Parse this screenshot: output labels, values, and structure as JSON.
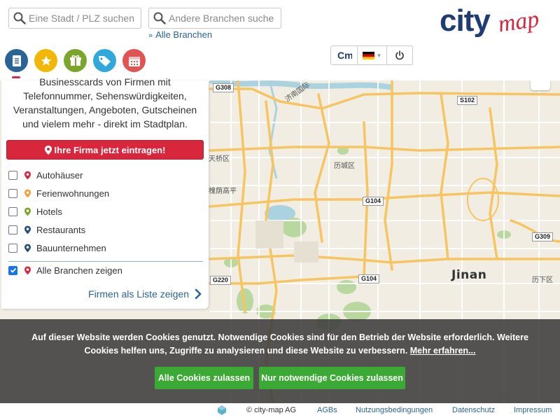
{
  "header": {
    "city_search_placeholder": "Eine Stadt / PLZ suchen",
    "branch_search_placeholder": "Andere Branchen suchen",
    "all_branches_link": "Alle Branchen",
    "logo_text_city": "city",
    "logo_text_map": "map"
  },
  "nav_icons": [
    {
      "name": "list-icon",
      "color": "#2a6496",
      "active": true
    },
    {
      "name": "star-icon",
      "color": "#f2b705"
    },
    {
      "name": "gift-icon",
      "color": "#7aa62b"
    },
    {
      "name": "tag-icon",
      "color": "#31a8d9"
    },
    {
      "name": "calendar-icon",
      "color": "#e05552"
    }
  ],
  "toolbar": {
    "logo_badge": "Cm",
    "language": "de",
    "power": "power-icon"
  },
  "sidebar": {
    "intro_lines": [
      "Businesscards von Firmen mit",
      "Telefonnummer, Sehenswürdigkeiten,",
      "Veranstaltungen, Angeboten, Gutscheinen",
      "und vielem mehr - direkt im Stadtplan."
    ],
    "cta_label": "Ihre Firma jetzt eintragen!",
    "branches": [
      {
        "label": "Autohäuser",
        "pin_color": "#d8273d",
        "checked": false
      },
      {
        "label": "Ferienwohnungen",
        "pin_color": "#f0a030",
        "checked": false
      },
      {
        "label": "Hotels",
        "pin_color": "#7aa62b",
        "checked": false
      },
      {
        "label": "Restaurants",
        "pin_color": "#2a4f7a",
        "checked": false
      },
      {
        "label": "Bauunternehmen",
        "pin_color": "#2a4f7a",
        "checked": false
      }
    ],
    "all_branches": {
      "label": "Alle Branchen zeigen",
      "pin_color": "#d8273d",
      "checked": true
    },
    "list_link": "Firmen als Liste zeigen"
  },
  "map": {
    "road_badges": [
      "G308",
      "S102",
      "G104",
      "G309",
      "G220",
      "G104"
    ],
    "district_labels": [
      "天桥区",
      "历城区",
      "济南国际",
      "槐荫高平",
      "历下区"
    ],
    "city_name": "Jinan"
  },
  "cookie_banner": {
    "text": "Auf dieser Website werden Cookies genutzt. Notwendige Cookies sind für den Betrieb der Website erforderlich. Weitere Cookies helfen uns, Zugriffe zu analysieren und diese Website zu verbessern.",
    "more_link": "Mehr erfahren...",
    "accept_all": "Alle Cookies zulassen",
    "accept_necessary": "Nur notwendige Cookies zulassen"
  },
  "footer": {
    "copyright": "© city-map AG",
    "links": [
      "AGBs",
      "Nutzungsbedingungen",
      "Datenschutz",
      "Impressum"
    ]
  },
  "colors": {
    "brand_navy": "#1f3b73",
    "brand_red": "#d8273d",
    "link_blue": "#2a6496",
    "cookie_green": "#3aaa35"
  }
}
